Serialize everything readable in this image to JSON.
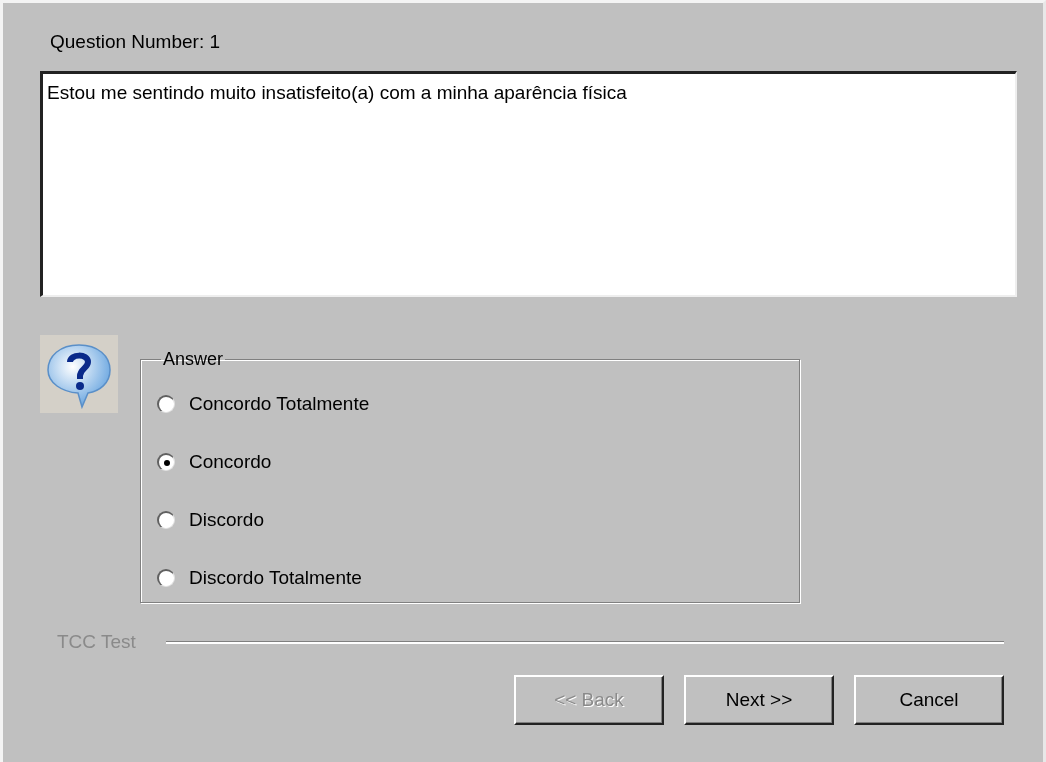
{
  "question_label": "Question Number: 1",
  "question_text": "Estou me sentindo muito insatisfeito(a) com a minha aparência física",
  "answer": {
    "legend": "Answer",
    "options": [
      {
        "label": "Concordo Totalmente",
        "selected": false
      },
      {
        "label": "Concordo",
        "selected": true
      },
      {
        "label": "Discordo",
        "selected": false
      },
      {
        "label": "Discordo Totalmente",
        "selected": false
      }
    ]
  },
  "footer_label": "TCC Test",
  "buttons": [
    {
      "label": "<< Back",
      "disabled": true
    },
    {
      "label": "Next >>",
      "disabled": false
    },
    {
      "label": "Cancel",
      "disabled": false
    }
  ]
}
